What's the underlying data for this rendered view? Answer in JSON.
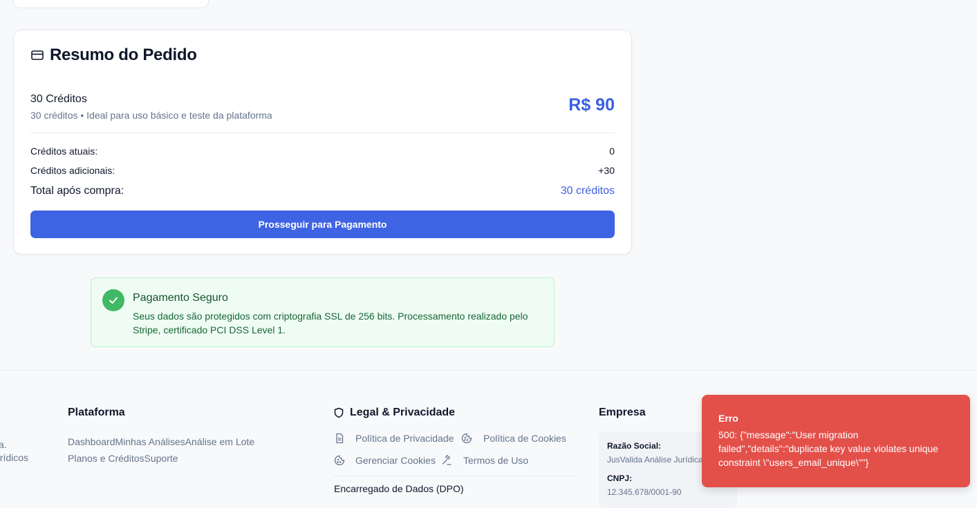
{
  "order": {
    "title": "Resumo do Pedido",
    "plan_name": "30 Créditos",
    "plan_desc": "30 créditos • Ideal para uso básico e teste da plataforma",
    "price": "R$ 90",
    "current_label": "Créditos atuais:",
    "current_value": "0",
    "additional_label": "Créditos adicionais:",
    "additional_value": "+30",
    "total_label": "Total após compra:",
    "total_value": "30 créditos",
    "button_label": "Prosseguir para Pagamento"
  },
  "secure": {
    "title": "Pagamento Seguro",
    "text": "Seus dados são protegidos com criptografia SSL de 256 bits. Processamento realizado pelo Stripe, certificado PCI DSS Level 1."
  },
  "footer": {
    "left_partial_1": "a.",
    "left_partial_2": "urídicos",
    "platform": {
      "heading": "Plataforma",
      "links": [
        "Dashboard",
        "Minhas Análises",
        "Análise em Lote",
        "Planos e Créditos",
        "Suporte"
      ]
    },
    "legal": {
      "heading": "Legal & Privacidade",
      "privacy": "Política de Privacidade",
      "cookies": "Política de Cookies",
      "manage_cookies": "Gerenciar Cookies",
      "terms": "Termos de Uso",
      "dpo": "Encarregado de Dados (DPO)"
    },
    "company": {
      "heading": "Empresa",
      "razao_label": "Razão Social:",
      "razao_value": "JusValida Análise Jurídica",
      "cnpj_label": "CNPJ:",
      "cnpj_value": "12.345.678/0001-90"
    }
  },
  "toast": {
    "title": "Erro",
    "message": "500: {\"message\":\"User migration failed\",\"details\":\"duplicate key value violates unique constraint \\\"users_email_unique\\\"\"}"
  },
  "colors": {
    "accent": "#3e63e3",
    "price": "#3b5fe0",
    "success_bg": "#effcf3",
    "success_icon": "#41b865",
    "error": "#e3504a"
  },
  "icons": {
    "order": "credit-card-icon",
    "secure": "check-icon",
    "legal": "shield-icon",
    "privacy": "document-icon",
    "cookies": "cookie-icon",
    "terms": "gavel-icon"
  }
}
